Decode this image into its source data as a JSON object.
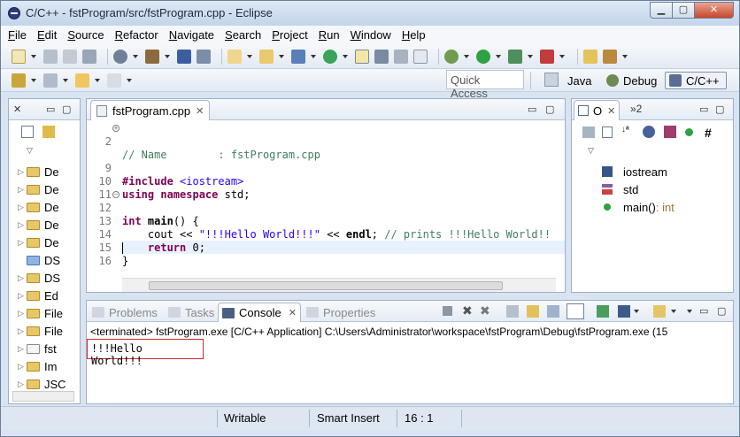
{
  "window": {
    "title": "C/C++ - fstProgram/src/fstProgram.cpp - Eclipse"
  },
  "menu": [
    "File",
    "Edit",
    "Source",
    "Refactor",
    "Navigate",
    "Search",
    "Project",
    "Run",
    "Window",
    "Help"
  ],
  "quick_access": {
    "placeholder": "Quick Access"
  },
  "perspectives": [
    "Java",
    "Debug",
    "C/C++"
  ],
  "project_explorer": {
    "items": [
      "De",
      "De",
      "De",
      "De",
      "De",
      "DS",
      "DS",
      "Ed",
      "File",
      "File",
      "fst",
      "Im",
      "JSC"
    ]
  },
  "editor": {
    "tab": "fstProgram.cpp",
    "lines": [
      {
        "num": "2",
        "code": "// Name        : fstProgram.cpp"
      },
      {
        "num": "9",
        "code": "#include <iostream>"
      },
      {
        "num": "10",
        "code": "using namespace std;"
      },
      {
        "num": "11",
        "code": ""
      },
      {
        "num": "12",
        "code": "int main() {"
      },
      {
        "num": "13",
        "code": "    cout << \"!!!Hello World!!!\" << endl; // prints !!!Hello World!!"
      },
      {
        "num": "14",
        "code": "    return 0;"
      },
      {
        "num": "15",
        "code": "}"
      },
      {
        "num": "16",
        "code": ""
      }
    ]
  },
  "outline": {
    "tab_outline": "O",
    "tab_other": "»2",
    "items": [
      {
        "label": "iostream",
        "suffix": ""
      },
      {
        "label": "std",
        "suffix": ""
      },
      {
        "label": "main()",
        "suffix": " : int"
      }
    ]
  },
  "bottom_panel": {
    "tabs": [
      "Problems",
      "Tasks",
      "Console",
      "Properties"
    ],
    "active_tab": "Console",
    "terminated_text": "<terminated> fstProgram.exe [C/C++ Application] C:\\Users\\Administrator\\workspace\\fstProgram\\Debug\\fstProgram.exe (15",
    "output": "!!!Hello World!!!"
  },
  "status_bar": {
    "writable": "Writable",
    "insert_mode": "Smart Insert",
    "position": "16 : 1"
  }
}
